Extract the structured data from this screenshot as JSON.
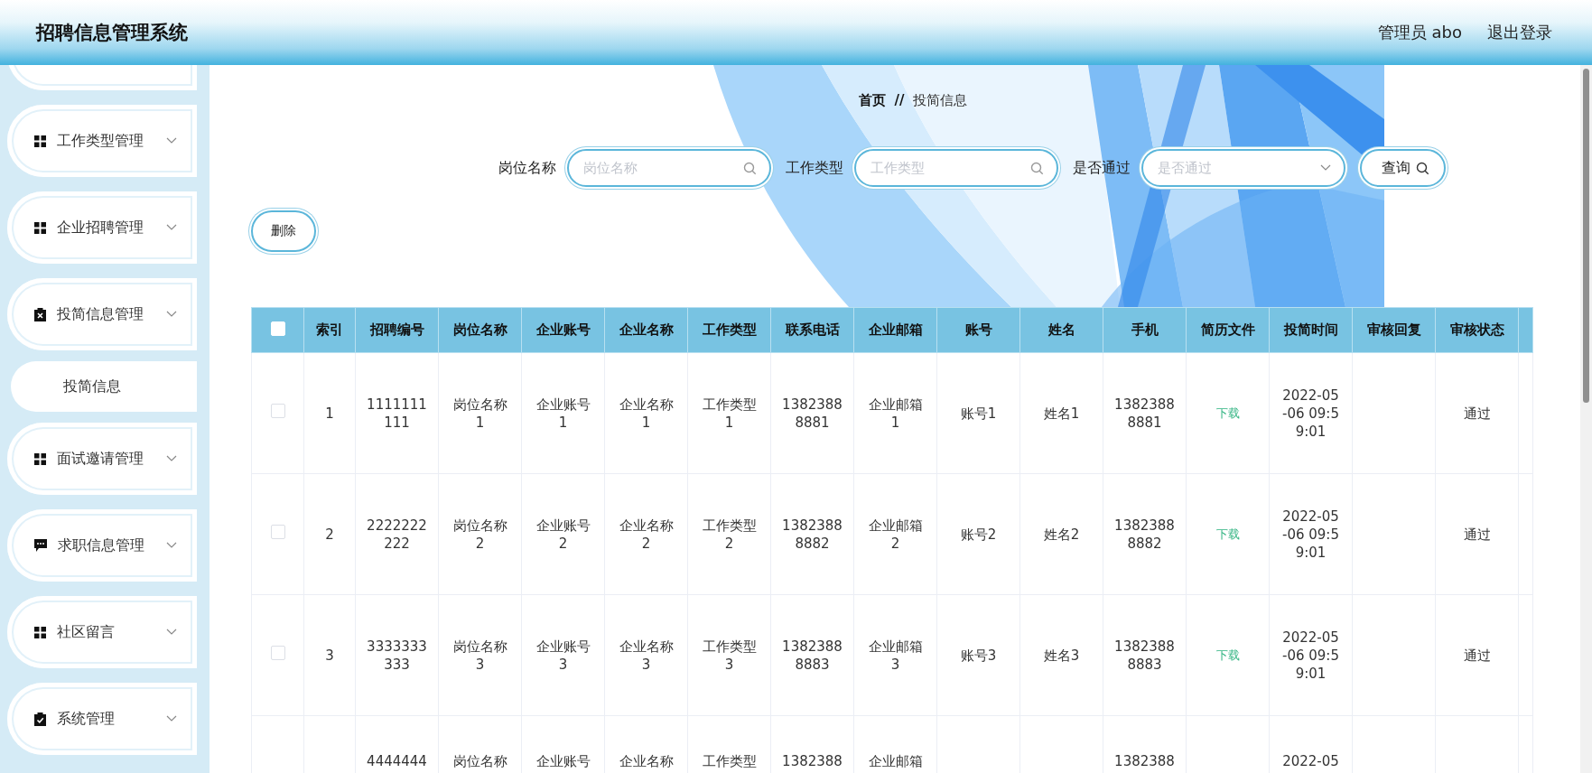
{
  "header": {
    "title": "招聘信息管理系统",
    "user": "管理员 abo",
    "logout": "退出登录"
  },
  "sidebar": {
    "items": [
      {
        "label": "工作类型管理"
      },
      {
        "label": "企业招聘管理"
      },
      {
        "label": "投简信息管理",
        "children": [
          {
            "label": "投简信息"
          }
        ]
      },
      {
        "label": "面试邀请管理"
      },
      {
        "label": "求职信息管理"
      },
      {
        "label": "社区留言"
      },
      {
        "label": "系统管理"
      }
    ]
  },
  "breadcrumb": {
    "home": "首页",
    "separator": "//",
    "current": "投简信息"
  },
  "filters": [
    {
      "label": "岗位名称",
      "placeholder": "岗位名称",
      "kind": "input"
    },
    {
      "label": "工作类型",
      "placeholder": "工作类型",
      "kind": "input"
    },
    {
      "label": "是否通过",
      "placeholder": "是否通过",
      "kind": "select"
    }
  ],
  "search_button": "查询",
  "delete_button": "删除",
  "table": {
    "select_all_checked": false,
    "columns": [
      "索引",
      "招聘编号",
      "岗位名称",
      "企业账号",
      "企业名称",
      "工作类型",
      "联系电话",
      "企业邮箱",
      "账号",
      "姓名",
      "手机",
      "简历文件",
      "投简时间",
      "审核回复",
      "审核状态"
    ],
    "rows": [
      {
        "checked": false,
        "cut_off": false,
        "cells": [
          "1",
          "1111111111",
          "岗位名称1",
          "企业账号1",
          "企业名称1",
          "工作类型1",
          "13823888881",
          "企业邮箱1",
          "账号1",
          "姓名1",
          "13823888881",
          {
            "link": "下载"
          },
          "2022-05-06 09:59:01",
          null,
          "通过"
        ]
      },
      {
        "checked": false,
        "cut_off": false,
        "cells": [
          "2",
          "2222222222",
          "岗位名称2",
          "企业账号2",
          "企业名称2",
          "工作类型2",
          "13823888882",
          "企业邮箱2",
          "账号2",
          "姓名2",
          "13823888882",
          {
            "link": "下载"
          },
          "2022-05-06 09:59:01",
          null,
          "通过"
        ]
      },
      {
        "checked": false,
        "cut_off": false,
        "cells": [
          "3",
          "3333333333",
          "岗位名称3",
          "企业账号3",
          "企业名称3",
          "工作类型3",
          "13823888883",
          "企业邮箱3",
          "账号3",
          "姓名3",
          "13823888883",
          {
            "link": "下载"
          },
          "2022-05-06 09:59:01",
          null,
          "通过"
        ]
      },
      {
        "cut_off": true,
        "cells": [
          null,
          "4444444",
          "岗位名称",
          "企业账号",
          "企业名称",
          "工作类型",
          "1382388",
          "企业邮箱",
          null,
          null,
          "1382388",
          null,
          "2022-05",
          null,
          null
        ]
      }
    ]
  }
}
